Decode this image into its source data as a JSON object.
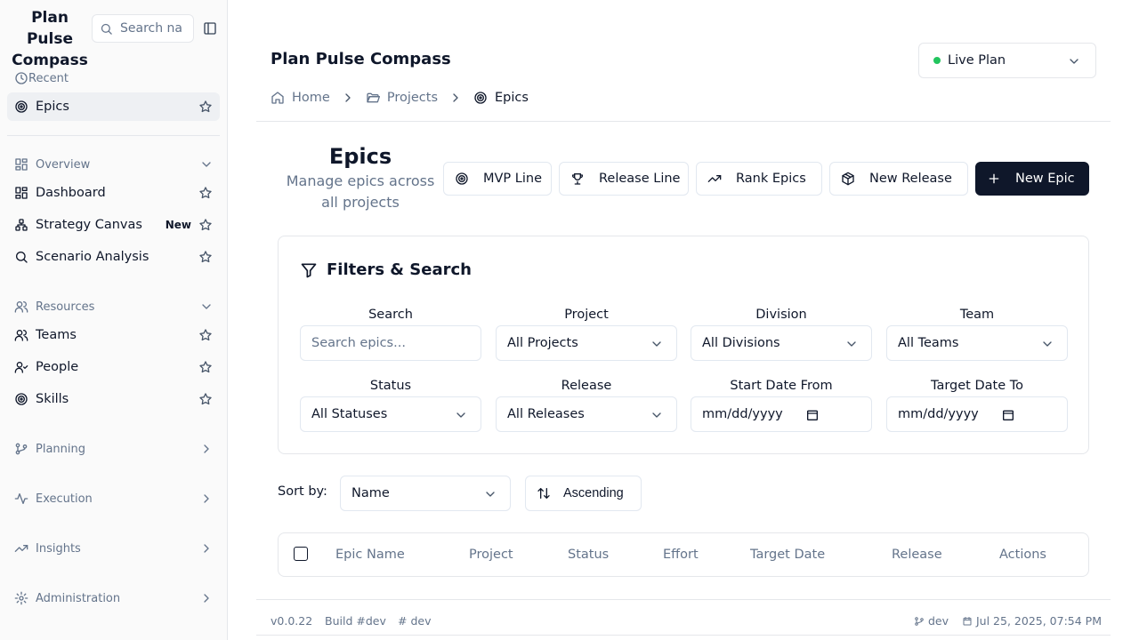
{
  "sidebar": {
    "brand": "Plan Pulse Compass",
    "search_placeholder": "Search na",
    "recent_label": "Recent",
    "recent_item": "Epics",
    "overview": {
      "label": "Overview",
      "items": [
        "Dashboard",
        "Strategy Canvas",
        "Scenario Analysis"
      ],
      "new_badge": "New"
    },
    "resources": {
      "label": "Resources",
      "items": [
        "Teams",
        "People",
        "Skills"
      ]
    },
    "groups": [
      "Planning",
      "Execution",
      "Insights",
      "Administration"
    ]
  },
  "header": {
    "title": "Plan Pulse Compass",
    "plan_select": "Live Plan",
    "plan_status_color": "#22c55e",
    "breadcrumb": [
      "Home",
      "Projects",
      "Epics"
    ]
  },
  "epics": {
    "title": "Epics",
    "subtitle": "Manage epics across all projects",
    "buttons": {
      "mvp_line": "MVP Line",
      "release_line": "Release Line",
      "rank_epics": "Rank Epics",
      "new_release": "New Release",
      "new_epic": "New Epic"
    }
  },
  "filters": {
    "title": "Filters & Search",
    "search_label": "Search",
    "search_placeholder": "Search epics...",
    "project_label": "Project",
    "project_value": "All Projects",
    "division_label": "Division",
    "division_value": "All Divisions",
    "team_label": "Team",
    "team_value": "All Teams",
    "status_label": "Status",
    "status_value": "All Statuses",
    "release_label": "Release",
    "release_value": "All Releases",
    "start_label": "Start Date From",
    "start_value": "mm/dd/yyyy",
    "target_label": "Target Date To",
    "target_value": "mm/dd/yyyy"
  },
  "sort": {
    "label": "Sort by:",
    "value": "Name",
    "order": "Ascending"
  },
  "table": {
    "columns": [
      "Epic Name",
      "Project",
      "Status",
      "Effort",
      "Target Date",
      "Release",
      "Actions"
    ]
  },
  "footer": {
    "version": "v0.0.22",
    "build": "Build #dev",
    "tag": "# dev",
    "branch": "dev",
    "timestamp": "Jul 25, 2025, 07:54 PM"
  },
  "colors": {
    "primary": "#0f172a",
    "muted": "#64748b",
    "border": "#e5e7eb"
  }
}
